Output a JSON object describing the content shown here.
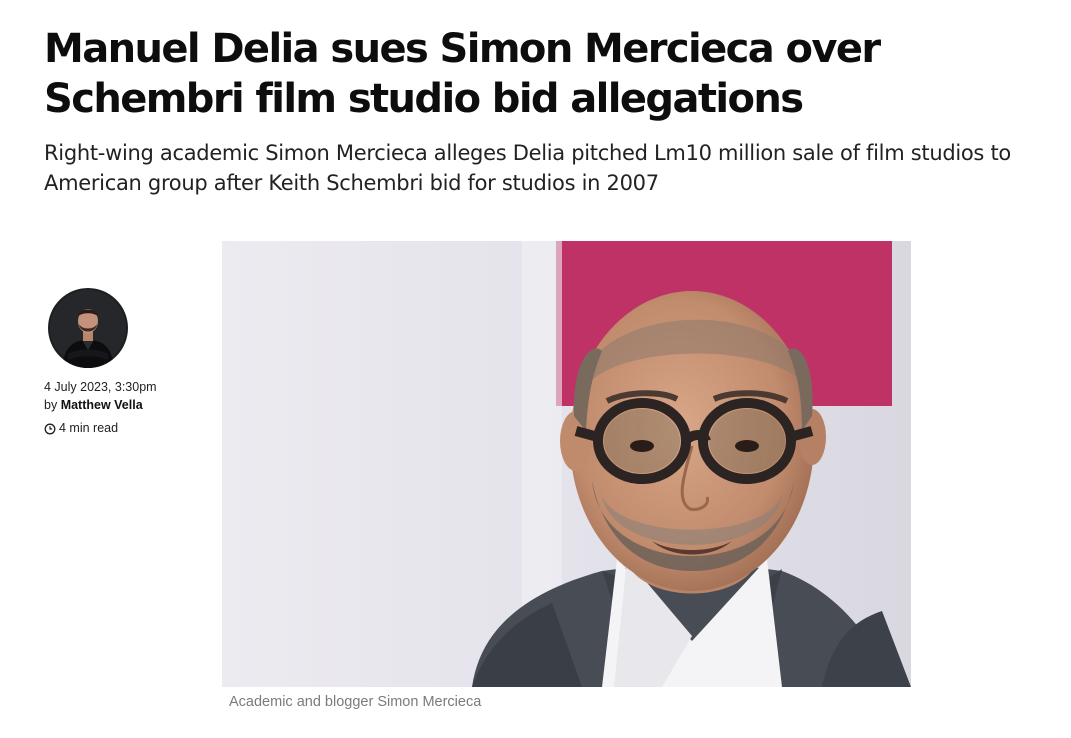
{
  "article": {
    "headline": "Manuel Delia sues Simon Mercieca over Schembri film studio bid allegations",
    "subheadline": "Right-wing academic Simon Mercieca alleges Delia pitched Lm10 million sale of film studios to American group after Keith Schembri bid for studios in 2007"
  },
  "byline": {
    "date": "4 July 2023, 3:30pm",
    "by_prefix": "by",
    "author": "Matthew Vella",
    "read_time": "4 min read",
    "icons": {
      "read_time": "clock-icon"
    }
  },
  "image": {
    "caption": "Academic and blogger Simon Mercieca"
  },
  "colors": {
    "accent_backdrop": "#c8366a",
    "text": "#111111",
    "caption": "#7b7b7b"
  }
}
